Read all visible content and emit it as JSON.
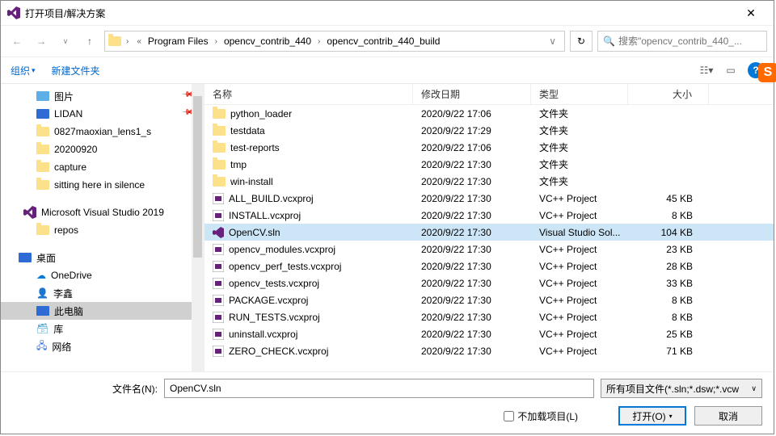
{
  "title": "打开项目/解决方案",
  "breadcrumb": {
    "segments": [
      "Program Files",
      "opencv_contrib_440",
      "opencv_contrib_440_build"
    ]
  },
  "search": {
    "placeholder": "搜索\"opencv_contrib_440_..."
  },
  "toolbar": {
    "organize": "组织",
    "newfolder": "新建文件夹"
  },
  "sidebar": {
    "items": [
      {
        "label": "图片",
        "icon": "pictures",
        "pin": true
      },
      {
        "label": "LIDAN",
        "icon": "monitor",
        "pin": true
      },
      {
        "label": "0827maoxian_lens1_s",
        "icon": "folder"
      },
      {
        "label": "20200920",
        "icon": "folder"
      },
      {
        "label": "capture",
        "icon": "folder"
      },
      {
        "label": "sitting here in silence",
        "icon": "folder"
      }
    ],
    "vs": {
      "label": "Microsoft Visual Studio 2019"
    },
    "repos": {
      "label": "repos"
    },
    "desktop": {
      "label": "桌面"
    },
    "onedrive": {
      "label": "OneDrive"
    },
    "user": {
      "label": "李鑫"
    },
    "thispc": {
      "label": "此电脑"
    },
    "libraries": {
      "label": "库"
    },
    "network": {
      "label": "网络"
    }
  },
  "columns": {
    "name": "名称",
    "date": "修改日期",
    "type": "类型",
    "size": "大小"
  },
  "files": [
    {
      "name": "python_loader",
      "date": "2020/9/22 17:06",
      "type": "文件夹",
      "size": "",
      "icon": "folder"
    },
    {
      "name": "testdata",
      "date": "2020/9/22 17:29",
      "type": "文件夹",
      "size": "",
      "icon": "folder"
    },
    {
      "name": "test-reports",
      "date": "2020/9/22 17:06",
      "type": "文件夹",
      "size": "",
      "icon": "folder"
    },
    {
      "name": "tmp",
      "date": "2020/9/22 17:30",
      "type": "文件夹",
      "size": "",
      "icon": "folder"
    },
    {
      "name": "win-install",
      "date": "2020/9/22 17:30",
      "type": "文件夹",
      "size": "",
      "icon": "folder"
    },
    {
      "name": "ALL_BUILD.vcxproj",
      "date": "2020/9/22 17:30",
      "type": "VC++ Project",
      "size": "45 KB",
      "icon": "vcx"
    },
    {
      "name": "INSTALL.vcxproj",
      "date": "2020/9/22 17:30",
      "type": "VC++ Project",
      "size": "8 KB",
      "icon": "vcx"
    },
    {
      "name": "OpenCV.sln",
      "date": "2020/9/22 17:30",
      "type": "Visual Studio Sol...",
      "size": "104 KB",
      "icon": "sln",
      "selected": true
    },
    {
      "name": "opencv_modules.vcxproj",
      "date": "2020/9/22 17:30",
      "type": "VC++ Project",
      "size": "23 KB",
      "icon": "vcx"
    },
    {
      "name": "opencv_perf_tests.vcxproj",
      "date": "2020/9/22 17:30",
      "type": "VC++ Project",
      "size": "28 KB",
      "icon": "vcx"
    },
    {
      "name": "opencv_tests.vcxproj",
      "date": "2020/9/22 17:30",
      "type": "VC++ Project",
      "size": "33 KB",
      "icon": "vcx"
    },
    {
      "name": "PACKAGE.vcxproj",
      "date": "2020/9/22 17:30",
      "type": "VC++ Project",
      "size": "8 KB",
      "icon": "vcx"
    },
    {
      "name": "RUN_TESTS.vcxproj",
      "date": "2020/9/22 17:30",
      "type": "VC++ Project",
      "size": "8 KB",
      "icon": "vcx"
    },
    {
      "name": "uninstall.vcxproj",
      "date": "2020/9/22 17:30",
      "type": "VC++ Project",
      "size": "25 KB",
      "icon": "vcx"
    },
    {
      "name": "ZERO_CHECK.vcxproj",
      "date": "2020/9/22 17:30",
      "type": "VC++ Project",
      "size": "71 KB",
      "icon": "vcx"
    }
  ],
  "bottom": {
    "filename_label": "文件名(N):",
    "filename_value": "OpenCV.sln",
    "filetype": "所有项目文件(*.sln;*.dsw;*.vcw",
    "noload": "不加载项目(L)",
    "open": "打开(O)",
    "cancel": "取消"
  },
  "s_badge": "S"
}
